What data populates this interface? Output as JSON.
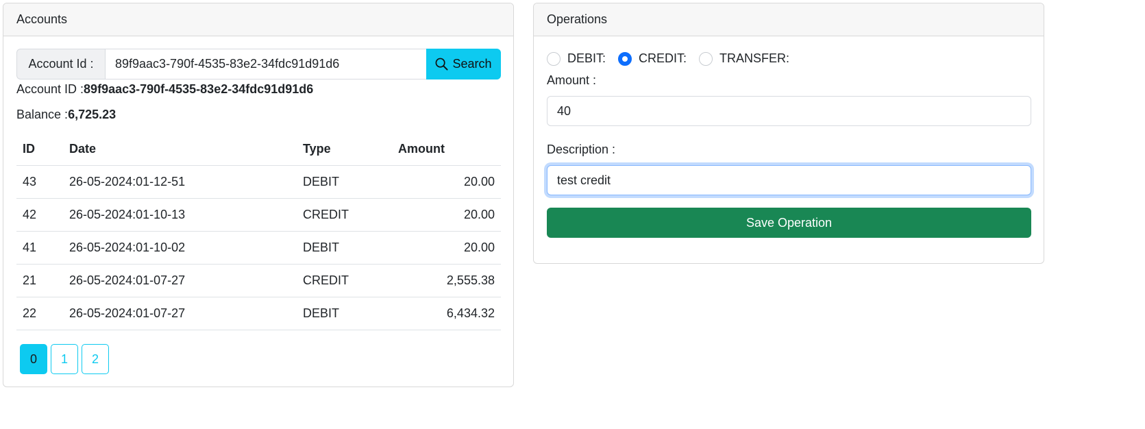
{
  "accounts": {
    "header": "Accounts",
    "search": {
      "label": "Account Id :",
      "value": "89f9aac3-790f-4535-83e2-34fdc91d91d6",
      "button_label": "Search"
    },
    "account_id_label": "Account ID :",
    "account_id_value": "89f9aac3-790f-4535-83e2-34fdc91d91d6",
    "balance_label": "Balance :",
    "balance_value": "6,725.23",
    "table": {
      "headers": [
        "ID",
        "Date",
        "Type",
        "Amount"
      ],
      "rows": [
        {
          "id": "43",
          "date": "26-05-2024:01-12-51",
          "type": "DEBIT",
          "amount": "20.00"
        },
        {
          "id": "42",
          "date": "26-05-2024:01-10-13",
          "type": "CREDIT",
          "amount": "20.00"
        },
        {
          "id": "41",
          "date": "26-05-2024:01-10-02",
          "type": "DEBIT",
          "amount": "20.00"
        },
        {
          "id": "21",
          "date": "26-05-2024:01-07-27",
          "type": "CREDIT",
          "amount": "2,555.38"
        },
        {
          "id": "22",
          "date": "26-05-2024:01-07-27",
          "type": "DEBIT",
          "amount": "6,434.32"
        }
      ]
    },
    "pages": [
      "0",
      "1",
      "2"
    ],
    "active_page": "0"
  },
  "operations": {
    "header": "Operations",
    "types": [
      {
        "label": "DEBIT:",
        "checked": false
      },
      {
        "label": "CREDIT:",
        "checked": true
      },
      {
        "label": "TRANSFER:",
        "checked": false
      }
    ],
    "amount_label": "Amount :",
    "amount_value": "40",
    "description_label": "Description :",
    "description_value": "test credit",
    "save_label": "Save Operation"
  },
  "colors": {
    "info": "#0dcaf0",
    "success": "#198754",
    "primary": "#0d6efd"
  }
}
